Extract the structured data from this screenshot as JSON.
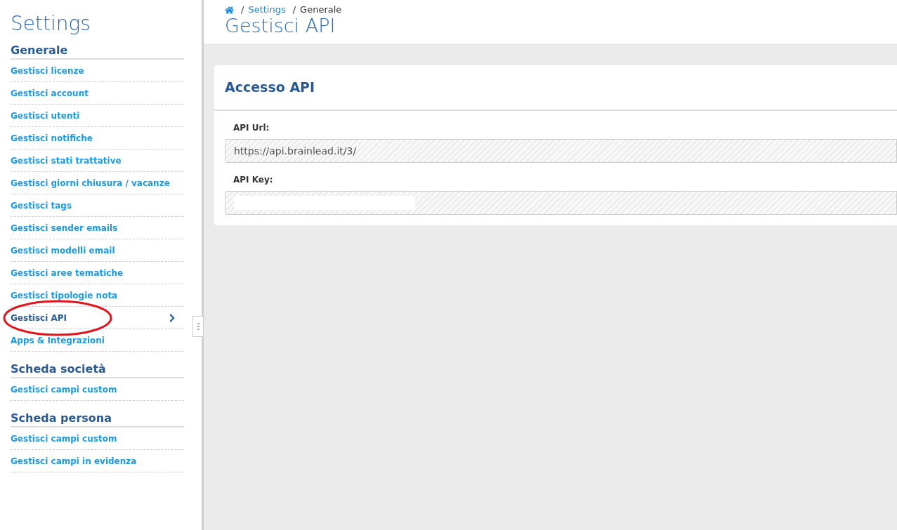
{
  "sidebar": {
    "title": "Settings",
    "sections": [
      {
        "title": "Generale",
        "items": [
          {
            "label": "Gestisci licenze",
            "selected": false,
            "circled": false
          },
          {
            "label": "Gestisci account",
            "selected": false,
            "circled": false
          },
          {
            "label": "Gestisci utenti",
            "selected": false,
            "circled": false
          },
          {
            "label": "Gestisci notifiche",
            "selected": false,
            "circled": false
          },
          {
            "label": "Gestisci stati trattative",
            "selected": false,
            "circled": false
          },
          {
            "label": "Gestisci giorni chiusura / vacanze",
            "selected": false,
            "circled": false
          },
          {
            "label": "Gestisci tags",
            "selected": false,
            "circled": false
          },
          {
            "label": "Gestisci sender emails",
            "selected": false,
            "circled": false
          },
          {
            "label": "Gestisci modelli email",
            "selected": false,
            "circled": false
          },
          {
            "label": "Gestisci aree tematiche",
            "selected": false,
            "circled": false
          },
          {
            "label": "Gestisci tipologie nota",
            "selected": false,
            "circled": false
          },
          {
            "label": "Gestisci API",
            "selected": true,
            "circled": true
          },
          {
            "label": "Apps & Integrazioni",
            "selected": false,
            "circled": false
          }
        ]
      },
      {
        "title": "Scheda società",
        "items": [
          {
            "label": "Gestisci campi custom",
            "selected": false,
            "circled": false
          }
        ]
      },
      {
        "title": "Scheda persona",
        "items": [
          {
            "label": "Gestisci campi custom",
            "selected": false,
            "circled": false
          },
          {
            "label": "Gestisci campi in evidenza",
            "selected": false,
            "circled": false
          }
        ]
      }
    ]
  },
  "breadcrumb": [
    {
      "separator": "/",
      "label": "Settings"
    },
    {
      "separator": "/",
      "label": "Generale"
    }
  ],
  "page_title": "Gestisci API",
  "card": {
    "title": "Accesso API",
    "fields": [
      {
        "label": "API Url:",
        "value": "https://api.brainlead.it/3/",
        "redacted": false
      },
      {
        "label": "API Key:",
        "redacted": true
      }
    ]
  }
}
